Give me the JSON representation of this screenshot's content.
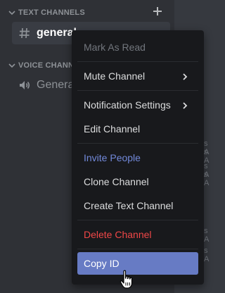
{
  "sidebar": {
    "text_category": "TEXT CHANNELS",
    "voice_category": "VOICE CHANNE",
    "channels": [
      {
        "name": "general",
        "icon": "hash-icon"
      },
      {
        "name": "General",
        "icon": "speaker-icon"
      }
    ]
  },
  "background_fragments": [
    "s A",
    "s A",
    "s A",
    "s A",
    "s A",
    "s A"
  ],
  "context_menu": {
    "items": [
      {
        "label": "Mark As Read",
        "state": "disabled"
      },
      {
        "label": "Mute Channel",
        "submenu": true
      },
      {
        "label": "Notification Settings",
        "submenu": true
      },
      {
        "label": "Edit Channel"
      },
      {
        "label": "Invite People",
        "state": "accent"
      },
      {
        "label": "Clone Channel"
      },
      {
        "label": "Create Text Channel"
      },
      {
        "label": "Delete Channel",
        "state": "danger"
      },
      {
        "label": "Copy ID",
        "state": "hovered"
      }
    ]
  },
  "colors": {
    "sidebar": "#2f3136",
    "chat": "#36393f",
    "menu": "#18191c",
    "accent": "#7289da",
    "hover": "#677bc4",
    "danger": "#f04747"
  },
  "cursor": "hand-pointer-icon"
}
